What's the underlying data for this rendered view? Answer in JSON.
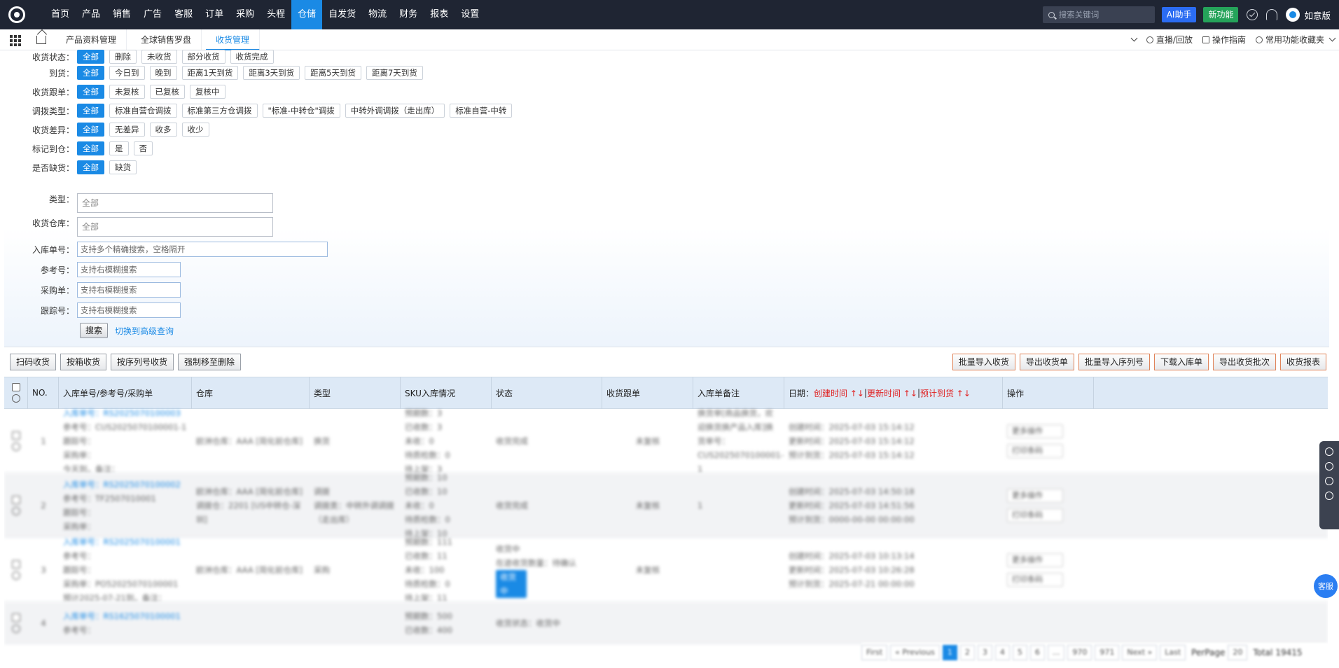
{
  "nav": {
    "menu": [
      "首页",
      "产品",
      "销售",
      "广告",
      "客服",
      "订单",
      "采购",
      "头程",
      "仓储",
      "自发货",
      "物流",
      "财务",
      "报表",
      "设置"
    ],
    "active_index": 8,
    "search_placeholder": "搜索关键词",
    "ai_label": "AI助手",
    "new_label": "新功能",
    "user_name": "如意版"
  },
  "tabs": {
    "items": [
      "产品资料管理",
      "全球销售罗盘",
      "收货管理"
    ],
    "active_index": 2,
    "right": [
      "直播/回放",
      "操作指南",
      "常用功能收藏夹"
    ]
  },
  "filters": {
    "status": {
      "label": "收货状态：",
      "options": [
        "全部",
        "删除",
        "未收货",
        "部分收货",
        "收货完成"
      ]
    },
    "arrival": {
      "label": "到货：",
      "options": [
        "全部",
        "今日到",
        "晚到",
        "距离1天到货",
        "距离3天到货",
        "距离5天到货",
        "距离7天到货"
      ]
    },
    "followup": {
      "label": "收货跟单：",
      "options": [
        "全部",
        "未复核",
        "已复核",
        "复核中"
      ]
    },
    "transfer": {
      "label": "调拨类型：",
      "options": [
        "全部",
        "标准自营仓调拨",
        "标准第三方仓调拨",
        "\"标准-中转仓\"调拨",
        "中转外调调拨（走出库）",
        "标准自营-中转"
      ]
    },
    "diff": {
      "label": "收货差异：",
      "options": [
        "全部",
        "无差异",
        "收多",
        "收少"
      ]
    },
    "marked": {
      "label": "标记到仓：",
      "options": [
        "全部",
        "是",
        "否"
      ]
    },
    "shortage": {
      "label": "是否缺货：",
      "options": [
        "全部",
        "缺货"
      ]
    },
    "type": {
      "label": "类型：",
      "value": "全部"
    },
    "warehouse": {
      "label": "收货仓库：",
      "value": "全部"
    },
    "inbound_no": {
      "label": "入库单号：",
      "placeholder": "支持多个精确搜索，空格隔开"
    },
    "ref_no": {
      "label": "参考号：",
      "placeholder": "支持右模糊搜索"
    },
    "po_no": {
      "label": "采购单：",
      "placeholder": "支持右模糊搜索"
    },
    "tracking_no": {
      "label": "跟踪号：",
      "placeholder": "支持右模糊搜索"
    },
    "search_button": "搜索",
    "advanced_link": "切换到高级查询"
  },
  "toolbar": {
    "left": [
      "扫码收货",
      "按箱收货",
      "按序列号收货",
      "强制移至删除"
    ],
    "right": [
      "批量导入收货",
      "导出收货单",
      "批量导入序列号",
      "下载入库单",
      "导出收货批次",
      "收货报表"
    ]
  },
  "table": {
    "headers": [
      "NO.",
      "入库单号/参考号/采购单",
      "仓库",
      "类型",
      "SKU入库情况",
      "状态",
      "收货跟单",
      "入库单备注",
      "日期：",
      "操作"
    ],
    "date_sorts": [
      "创建时间 ↑↓",
      "更新时间 ↑↓",
      "预计到货 ↑↓"
    ],
    "rows": [
      {
        "no": "1",
        "ids": [
          "入库单号：RS2025070100003",
          "参考号：CUS2025070100001-1",
          "跟踪号：",
          "采购单：",
          "今天到，备注："
        ],
        "warehouse": [
          "欧洲仓库：AAA [简化前仓库]"
        ],
        "type": [
          "换货"
        ],
        "sku": [
          "预期数：3",
          "已收数：3",
          "未收：0",
          "待质检数：0",
          "待上架：3"
        ],
        "status": [
          "收货完成"
        ],
        "follow": "未复核",
        "remark": "换货单[商品换货，欢迎换货换产品入库]换货单号：CUS2025070100001-1",
        "dates": [
          "创建时间：2025-07-03 15:14:12",
          "更新时间：2025-07-03 15:14:12",
          "预计到货：2025-07-03 15:14:12"
        ],
        "ops": [
          "更多操作",
          "打印条码"
        ]
      },
      {
        "no": "2",
        "ids": [
          "入库单号：RS2025070100002",
          "参考号：TF2507010001",
          "跟踪号：",
          "采购单："
        ],
        "warehouse": [
          "欧洲仓库：AAA [简化前仓库]",
          "调拨仓：2201 [US中转仓-深圳]"
        ],
        "type": [
          "调拨",
          "调拨类：中转外调调拨（走出库）"
        ],
        "sku": [
          "预期数：10",
          "已收数：10",
          "未收：0",
          "待质检数：0",
          "待上架：10"
        ],
        "status": [
          "收货完成"
        ],
        "follow": "未复核",
        "remark": "1",
        "dates": [
          "创建时间：2025-07-03 14:50:18",
          "更新时间：2025-07-03 14:51:56",
          "预计到货：0000-00-00 00:00:00"
        ],
        "ops": [
          "更多操作",
          "打印条码"
        ]
      },
      {
        "no": "3",
        "ids": [
          "入库单号：RS2025070100001",
          "参考号：",
          "跟踪号：",
          "采购单：PO52025070100001",
          "预计2025-07-21到，备注："
        ],
        "warehouse": [
          "欧洲仓库：AAA [简化前仓库]"
        ],
        "type": [
          "采购"
        ],
        "sku": [
          "预期数：111",
          "已收数：11",
          "未收：100",
          "待质检数：0",
          "待上架：11"
        ],
        "status": [
          "收货中",
          "在途收货数量：待确认"
        ],
        "status_badge": "收货中",
        "follow": "未复核",
        "remark": "",
        "dates": [
          "创建时间：2025-07-03 10:13:14",
          "更新时间：2025-07-03 10:26:28",
          "预计到货：2025-07-21 00:00:00"
        ],
        "ops": [
          "更多操作",
          "打印条码"
        ]
      },
      {
        "no": "4",
        "ids": [
          "入库单号：RS1625070100001",
          "参考号："
        ],
        "warehouse": [
          ""
        ],
        "type": [
          ""
        ],
        "sku": [
          "预期数：500",
          "已收数：400"
        ],
        "status": [
          "收货状态：收货中"
        ],
        "follow": "",
        "remark": "",
        "dates": [
          "",
          ""
        ],
        "ops": []
      }
    ]
  },
  "pager": {
    "items": [
      "First",
      "« Previous",
      "1",
      "2",
      "3",
      "4",
      "5",
      "6",
      "...",
      "970",
      "971",
      "Next »",
      "Last"
    ],
    "current": "1",
    "perpage_label": "PerPage",
    "perpage": "20",
    "total_label": "Total",
    "total": "19415"
  },
  "sidebar_fab": "客服"
}
